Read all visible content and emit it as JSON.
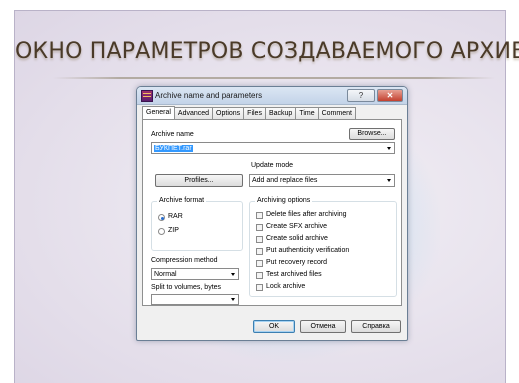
{
  "slide": {
    "title": "ОКНО ПАРАМЕТРОВ СОЗДАВАЕМОГО АРХИВА"
  },
  "dialog": {
    "title": "Archive name and parameters",
    "help_glyph": "?",
    "close_glyph": "✕",
    "tabs": [
      {
        "label": "General",
        "active": true
      },
      {
        "label": "Advanced"
      },
      {
        "label": "Options"
      },
      {
        "label": "Files"
      },
      {
        "label": "Backup"
      },
      {
        "label": "Time"
      },
      {
        "label": "Comment"
      }
    ],
    "archive_name_label": "Archive name",
    "archive_name_value": "БУКПЕТ.rar",
    "browse_label": "Browse...",
    "update_mode_label": "Update mode",
    "update_mode_value": "Add and replace files",
    "profiles_label": "Profiles...",
    "archive_format": {
      "title": "Archive format",
      "options": [
        {
          "label": "RAR",
          "selected": true
        },
        {
          "label": "ZIP",
          "selected": false
        }
      ]
    },
    "compression_label": "Compression method",
    "compression_value": "Normal",
    "split_label": "Split to volumes, bytes",
    "split_value": "",
    "archiving_options": {
      "title": "Archiving options",
      "items": [
        {
          "label": "Delete files after archiving",
          "checked": false
        },
        {
          "label": "Create SFX archive",
          "checked": false
        },
        {
          "label": "Create solid archive",
          "checked": false
        },
        {
          "label": "Put authenticity verification",
          "checked": false
        },
        {
          "label": "Put recovery record",
          "checked": false
        },
        {
          "label": "Test archived files",
          "checked": false
        },
        {
          "label": "Lock archive",
          "checked": false
        }
      ]
    },
    "buttons": {
      "ok": "OK",
      "cancel": "Отмена",
      "help": "Справка"
    }
  }
}
